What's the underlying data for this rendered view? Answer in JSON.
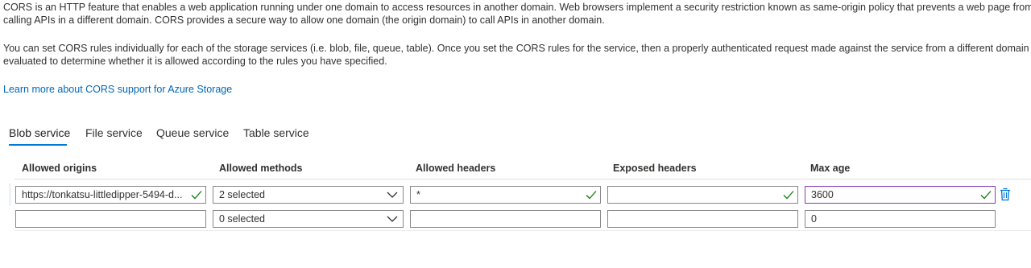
{
  "intro": {
    "p1_line1": "CORS is an HTTP feature that enables a web application running under one domain to access resources in another domain. Web browsers implement a security restriction known as same-origin policy that prevents a web page from",
    "p1_line2": "calling APIs in a different domain. CORS provides a secure way to allow one domain (the origin domain) to call APIs in another domain.",
    "p2_line1": "You can set CORS rules individually for each of the storage services (i.e. blob, file, queue, table). Once you set the CORS rules for the service, then a properly authenticated request made against the service from a different domain will be",
    "p2_line2": "evaluated to determine whether it is allowed according to the rules you have specified.",
    "learn_more_link": "Learn more about CORS support for Azure Storage"
  },
  "tabs": [
    {
      "label": "Blob service",
      "active": true
    },
    {
      "label": "File service",
      "active": false
    },
    {
      "label": "Queue service",
      "active": false
    },
    {
      "label": "Table service",
      "active": false
    }
  ],
  "columns": {
    "allowed_origins": "Allowed origins",
    "allowed_methods": "Allowed methods",
    "allowed_headers": "Allowed headers",
    "exposed_headers": "Exposed headers",
    "max_age": "Max age"
  },
  "rows": [
    {
      "allowed_origins": "https://tonkatsu-littledipper-5494-d...",
      "allowed_methods": "2 selected",
      "allowed_headers": "*",
      "exposed_headers": "",
      "max_age": "3600"
    },
    {
      "allowed_origins": "",
      "allowed_methods": "0 selected",
      "allowed_headers": "",
      "exposed_headers": "",
      "max_age": "0"
    }
  ],
  "icons": {
    "valid": "checkmark-icon",
    "dropdown": "chevron-down-icon",
    "delete": "trash-icon"
  },
  "colors": {
    "link": "#0067b8",
    "valid_check": "#107c10",
    "focus_border": "#8a3ab9",
    "tab_underline": "#0078d4",
    "delete_icon": "#0078d4"
  }
}
